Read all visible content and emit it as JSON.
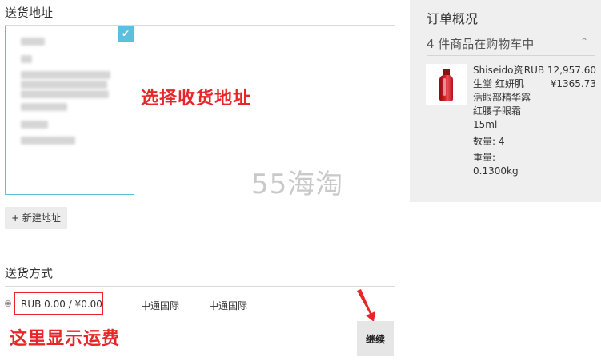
{
  "address_section": {
    "title": "送货地址",
    "add_button": "+ 新建地址",
    "annotation": "选择收货地址"
  },
  "watermark": "55海淘",
  "shipping_section": {
    "title": "送货方式",
    "price": "RUB 0.00 / ¥0.00",
    "carrier": "中通国际",
    "carrier_detail": "中通国际",
    "annotation": "这里显示运费",
    "continue_button": "继续"
  },
  "order_summary": {
    "title": "订单概况",
    "item_count_text": "4 件商品在购物车中",
    "product": {
      "name": "Shiseido资生堂 红妍肌活眼部精华露 红腰子眼霜 15ml",
      "price_rub": "RUB 12,957.60",
      "price_cny": "¥1365.73",
      "qty_text": "数量: 4",
      "weight_label": "重量:",
      "weight_value": "0.1300kg"
    }
  },
  "colors": {
    "accent_cyan": "#5bc0de",
    "annotation_red": "#e8262a",
    "panel_bg": "#efefef"
  },
  "icons": {
    "selected": "check-icon",
    "expand": "chevron-up-icon",
    "annotation_arrow": "arrow-icon"
  }
}
